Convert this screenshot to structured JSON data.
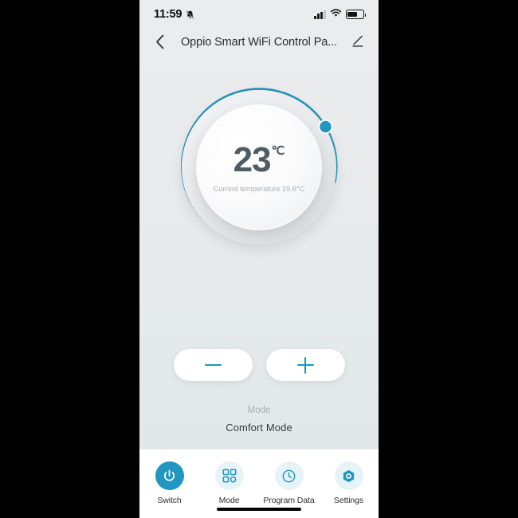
{
  "theme": {
    "accent": "#2196c0",
    "accent_light": "#1898c3",
    "tab_bg": "#e6f3f7",
    "screen_bg": "#e6eaec",
    "text_dark": "#2b2b2b",
    "text_muted": "#a8afb4",
    "temp_color": "#4e5c63"
  },
  "statusbar": {
    "time": "11:59",
    "mute_icon": "bell-slash-icon",
    "signal_icon": "cellular-signal-icon",
    "signal_bars": 3,
    "signal_bars_total": 4,
    "wifi_icon": "wifi-icon",
    "battery_icon": "battery-icon",
    "battery_level": 62
  },
  "header": {
    "back_icon": "chevron-left-icon",
    "title": "Oppio Smart WiFi Control Pa...",
    "edit_icon": "pencil-edit-icon"
  },
  "dial": {
    "target_temp": "23",
    "unit": "℃",
    "current_temp_text": "Current temperature 19.6°C",
    "handle_icon": "dial-handle",
    "arc_progress_pct": 76
  },
  "adjust": {
    "decrease_label": "−",
    "decrease_icon": "minus-icon",
    "increase_label": "+",
    "increase_icon": "plus-icon"
  },
  "mode": {
    "label": "Mode",
    "value": "Comfort  Mode"
  },
  "tabs": [
    {
      "label": "Switch",
      "icon": "power-icon",
      "active": true
    },
    {
      "label": "Mode",
      "icon": "grid-squares-icon",
      "active": false
    },
    {
      "label": "Program Data",
      "icon": "clock-icon",
      "active": false
    },
    {
      "label": "Settings",
      "icon": "hexagon-gear-icon",
      "active": false
    }
  ]
}
